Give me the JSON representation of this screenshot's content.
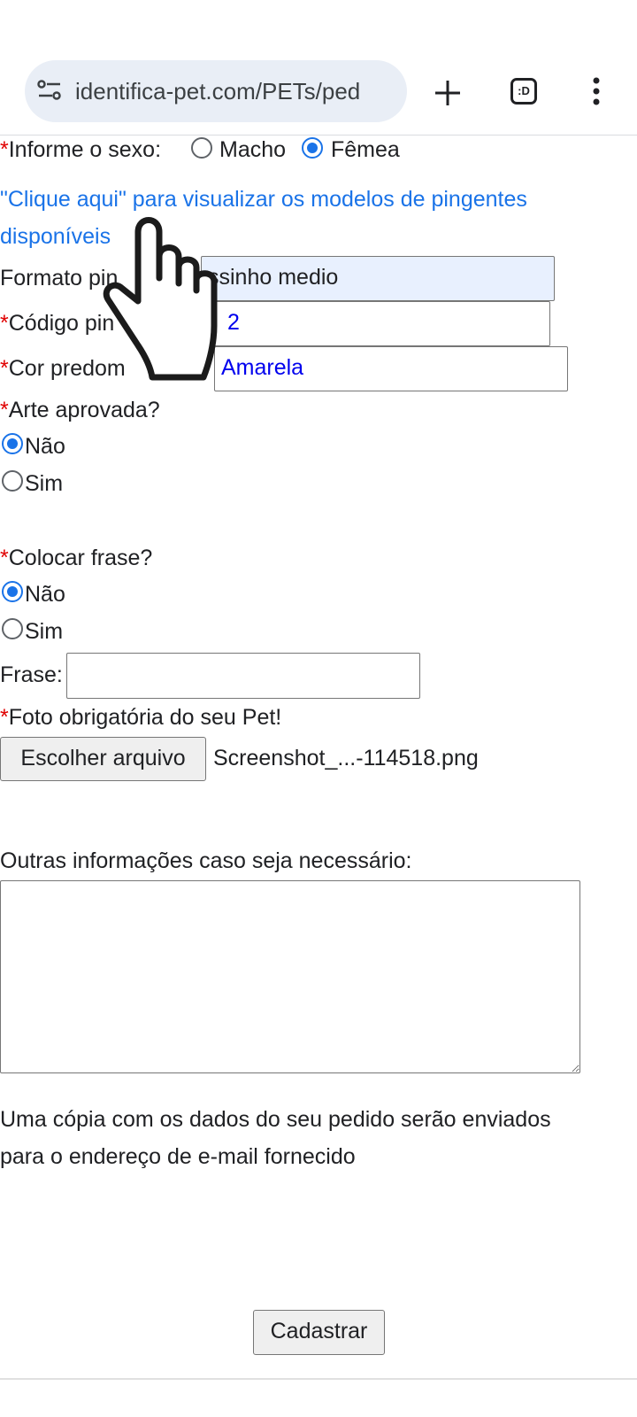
{
  "browser": {
    "url": "identifica-pet.com/PETs/ped",
    "tab_count_label": ":D"
  },
  "form": {
    "sexo": {
      "asterisk": "*",
      "label": "Informe o sexo:",
      "option_macho": "Macho",
      "option_femea": "Fêmea",
      "selected": "Fêmea"
    },
    "link_text_line1": "\"Clique aqui\" para visualizar os modelos de pingentes",
    "link_text_line2": "disponíveis",
    "formato": {
      "label": "Formato pin",
      "value": "ssinho medio"
    },
    "codigo": {
      "asterisk": "*",
      "label": "Código pin",
      "value": "2"
    },
    "cor": {
      "asterisk": "*",
      "label": "Cor predom",
      "value": "Amarela"
    },
    "arte": {
      "asterisk": "*",
      "label": "Arte aprovada?",
      "option_nao": "Não",
      "option_sim": "Sim",
      "selected": "Não"
    },
    "frase_q": {
      "asterisk": "*",
      "label": "Colocar frase?",
      "option_nao": "Não",
      "option_sim": "Sim",
      "selected": "Não"
    },
    "frase": {
      "label": "Frase:",
      "value": ""
    },
    "foto": {
      "asterisk": "*",
      "label": "Foto obrigatória do seu Pet!",
      "button": "Escolher arquivo",
      "filename": "Screenshot_...-114518.png"
    },
    "outras": {
      "label": "Outras informações caso seja necessário:",
      "value": ""
    },
    "note_line1": "Uma cópia com os dados do seu pedido serão enviados",
    "note_line2": "para o endereço de e-mail fornecido",
    "submit": "Cadastrar"
  },
  "colors": {
    "link": "#1a73e8",
    "required": "#e00000",
    "radio_selected": "#1a73e8",
    "autofill": "#e8f0fe"
  },
  "icons": [
    "site-settings-icon",
    "new-tab-plus-icon",
    "tab-switcher-icon",
    "more-vert-icon",
    "hand-pointer-cursor-icon"
  ]
}
